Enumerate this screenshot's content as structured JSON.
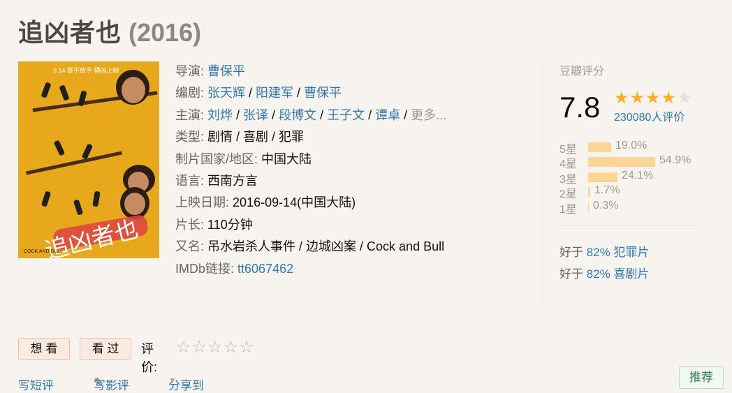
{
  "movie": {
    "title": "追凶者也",
    "year": "(2016)"
  },
  "poster": {
    "top_text": "9.14 誓不放手 横凶上映",
    "logo_text": "追凶者也",
    "bottom_text": "COCK AND BULL"
  },
  "info": {
    "director_label": "导演:",
    "director": "曹保平",
    "writer_label": "编剧:",
    "writers": [
      "张天辉",
      "阳建军",
      "曹保平"
    ],
    "cast_label": "主演:",
    "cast": [
      "刘烨",
      "张译",
      "段博文",
      "王子文",
      "谭卓"
    ],
    "cast_more": "更多...",
    "genre_label": "类型:",
    "genres": "剧情 / 喜剧 / 犯罪",
    "country_label": "制片国家/地区:",
    "country": "中国大陆",
    "language_label": "语言:",
    "language": "西南方言",
    "release_label": "上映日期:",
    "release": "2016-09-14(中国大陆)",
    "runtime_label": "片长:",
    "runtime": "110分钟",
    "aka_label": "又名:",
    "aka": "吊水岩杀人事件 / 边城凶案 / Cock and Bull",
    "imdb_label": "IMDb链接:",
    "imdb": "tt6067462"
  },
  "rating": {
    "header": "豆瓣评分",
    "score": "7.8",
    "stars_filled": 4,
    "votes": "230080人评价",
    "distribution": [
      {
        "label": "5星",
        "pct": "19.0%",
        "value": 19.0
      },
      {
        "label": "4星",
        "pct": "54.9%",
        "value": 54.9
      },
      {
        "label": "3星",
        "pct": "24.1%",
        "value": 24.1
      },
      {
        "label": "2星",
        "pct": "1.7%",
        "value": 1.7
      },
      {
        "label": "1星",
        "pct": "0.3%",
        "value": 0.3
      }
    ],
    "better_than": [
      {
        "prefix": "好于 ",
        "percent": "82%",
        "category": "犯罪片"
      },
      {
        "prefix": "好于 ",
        "percent": "82%",
        "category": "喜剧片"
      }
    ]
  },
  "actions": {
    "want": "想 看",
    "seen": "看 过",
    "rate_label": "评价:"
  },
  "bottom": {
    "short_review": "写短评",
    "long_review": "写影评",
    "share": "分享到",
    "recommend": "推荐"
  },
  "colors": {
    "link": "#3377aa",
    "star": "#ffac2d",
    "bar": "#ffd596",
    "background": "#f7f4ef"
  }
}
